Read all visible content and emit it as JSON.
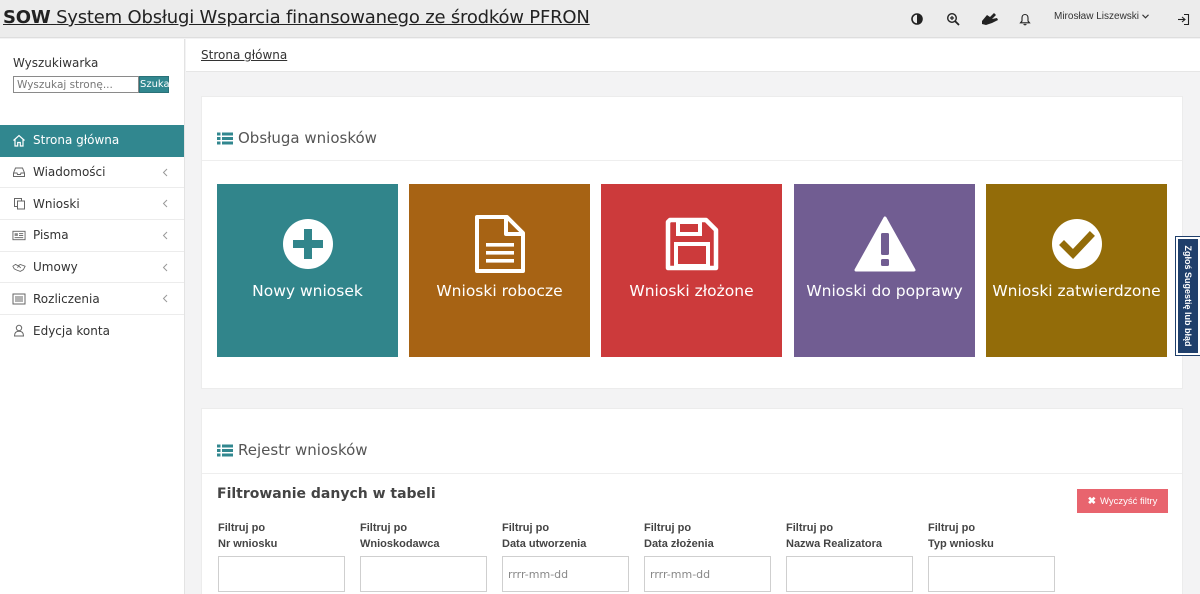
{
  "header": {
    "title_abbr": "SOW",
    "title_full": "System Obsługi Wsparcia finansowanego ze środków PFRON",
    "user_name": "Mirosław Liszewski",
    "icons": [
      "contrast-icon",
      "zoom-in-icon",
      "sign-language-icon",
      "bell-icon",
      "logout-icon"
    ]
  },
  "sidebar": {
    "search_label": "Wyszukiwarka",
    "search_placeholder": "Wyszukaj stronę...",
    "search_button": "Szukaj",
    "items": [
      {
        "label": "Strona główna",
        "icon": "home-icon",
        "active": true
      },
      {
        "label": "Wiadomości",
        "icon": "inbox-icon",
        "has_submenu": true
      },
      {
        "label": "Wnioski",
        "icon": "copy-icon",
        "has_submenu": true
      },
      {
        "label": "Pisma",
        "icon": "newspaper-icon",
        "has_submenu": true
      },
      {
        "label": "Umowy",
        "icon": "handshake-icon",
        "has_submenu": true
      },
      {
        "label": "Rozliczenia",
        "icon": "list-icon",
        "has_submenu": true
      },
      {
        "label": "Edycja konta",
        "icon": "user-icon"
      }
    ]
  },
  "breadcrumb": "Strona główna",
  "applications_panel": {
    "heading": "Obsługa wniosków",
    "tiles": [
      {
        "label": "Nowy wniosek",
        "icon": "plus-circle-icon",
        "color": "#31858b"
      },
      {
        "label": "Wnioski robocze",
        "icon": "document-icon",
        "color": "#a76314"
      },
      {
        "label": "Wnioski złożone",
        "icon": "floppy-disk-icon",
        "color": "#cc3a3b"
      },
      {
        "label": "Wnioski do poprawy",
        "icon": "warning-icon",
        "color": "#715d92"
      },
      {
        "label": "Wnioski zatwierdzone",
        "icon": "check-circle-icon",
        "color": "#936c09"
      }
    ]
  },
  "register_panel": {
    "heading": "Rejestr wniosków",
    "filter_title": "Filtrowanie danych w tabeli",
    "clear_button": "Wyczyść filtry",
    "filters": [
      {
        "line1": "Filtruj po",
        "line2": "Nr wniosku",
        "placeholder": ""
      },
      {
        "line1": "Filtruj po",
        "line2": "Wnioskodawca",
        "placeholder": ""
      },
      {
        "line1": "Filtruj po",
        "line2": "Data utworzenia",
        "placeholder": "rrrr-mm-dd"
      },
      {
        "line1": "Filtruj po",
        "line2": "Data złożenia",
        "placeholder": "rrrr-mm-dd"
      },
      {
        "line1": "Filtruj po",
        "line2": "Nazwa Realizatora",
        "placeholder": ""
      },
      {
        "line1": "Filtruj po",
        "line2": "Typ wniosku",
        "placeholder": ""
      }
    ]
  },
  "feedback_tab": "Zgłoś Sugestię lub błąd",
  "colors": {
    "accent": "#31878f",
    "clear_button": "#e8646e",
    "feedback_tab": "#1f3f6b"
  }
}
